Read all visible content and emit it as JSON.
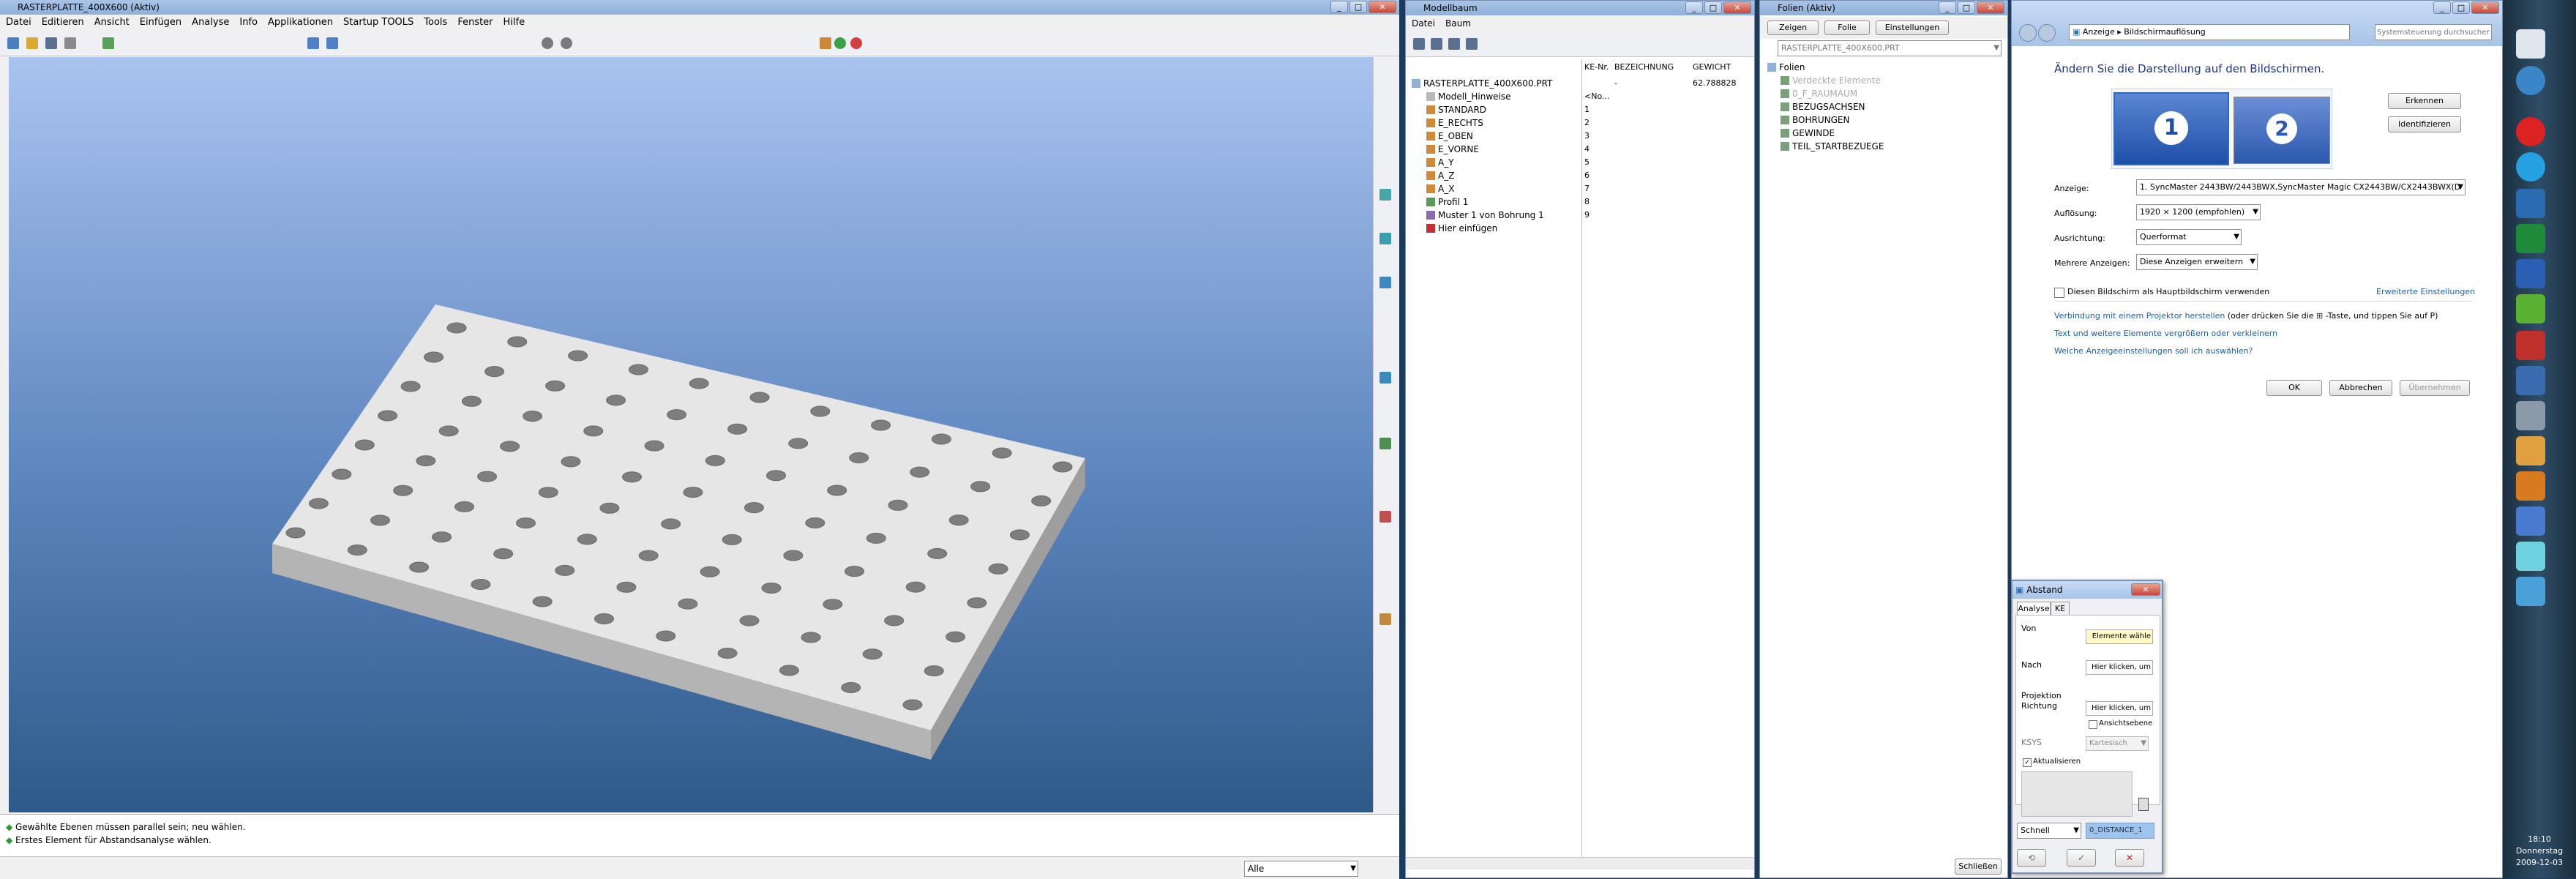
{
  "proe": {
    "title": "RASTERPLATTE_400X600 (Aktiv)",
    "menu": [
      "Datei",
      "Editieren",
      "Ansicht",
      "Einfügen",
      "Analyse",
      "Info",
      "Applikationen",
      "Startup TOOLS",
      "Tools",
      "Fenster",
      "Hilfe"
    ],
    "messages": [
      "Gewählte Ebenen müssen parallel sein; neu wählen.",
      "Erstes Element für Abstandsanalyse wählen."
    ],
    "filter_value": "Alle"
  },
  "modelltree": {
    "title": "Modellbaum",
    "menu": [
      "Datei",
      "Baum"
    ],
    "columns": [
      "KE-Nr.",
      "BEZEICHNUNG",
      "GEWICHT"
    ],
    "root": {
      "label": "RASTERPLATTE_400X600.PRT",
      "kenr": "",
      "bez": "-",
      "gew": "62.788828"
    },
    "items": [
      {
        "label": "Modell_Hinweise",
        "kenr": "<No..."
      },
      {
        "label": "STANDARD",
        "kenr": "1"
      },
      {
        "label": "E_RECHTS",
        "kenr": "2"
      },
      {
        "label": "E_OBEN",
        "kenr": "3"
      },
      {
        "label": "E_VORNE",
        "kenr": "4"
      },
      {
        "label": "A_Y",
        "kenr": "5"
      },
      {
        "label": "A_Z",
        "kenr": "6"
      },
      {
        "label": "A_X",
        "kenr": "7"
      },
      {
        "label": "Profil 1",
        "kenr": "8"
      },
      {
        "label": "Muster 1 von Bohrung 1",
        "kenr": "9"
      },
      {
        "label": "Hier einfügen",
        "kenr": ""
      }
    ]
  },
  "layers": {
    "title": "Folien (Aktiv)",
    "buttons": [
      "Zeigen",
      "Folie",
      "Einstellungen"
    ],
    "combo": "RASTERPLATTE_400X600.PRT",
    "items": [
      "Folien",
      "Verdeckte Elemente",
      "0_F_RAUMAUM",
      "BEZUGSACHSEN",
      "BOHRUNGEN",
      "GEWINDE",
      "TEIL_STARTBEZUEGE"
    ],
    "close": "Schließen"
  },
  "display": {
    "breadcrumb": [
      "Anzeige",
      "Bildschirmauflösung"
    ],
    "search_placeholder": "Systemsteuerung durchsuchen",
    "heading": "Ändern Sie die Darstellung auf den Bildschirmen.",
    "monitors": [
      "1",
      "2"
    ],
    "btn_detect": "Erkennen",
    "btn_identify": "Identifizieren",
    "labels": {
      "anzeige": "Anzeige:",
      "aufloesung": "Auflösung:",
      "ausrichtung": "Ausrichtung:",
      "mehrere": "Mehrere Anzeigen:"
    },
    "values": {
      "anzeige": "1. SyncMaster 2443BW/2443BWX,SyncMaster Magic CX2443BW/CX2443BWX(D",
      "aufloesung": "1920 × 1200 (empfohlen)",
      "ausrichtung": "Querformat",
      "mehrere": "Diese Anzeigen erweitern"
    },
    "checkbox_main": "Diesen Bildschirm als Hauptbildschirm verwenden",
    "advanced": "Erweiterte Einstellungen",
    "link1": "Verbindung mit einem Projektor herstellen",
    "link1_rest": "(oder drücken Sie die",
    "link1_rest2": "-Taste, und tippen Sie auf P)",
    "link2": "Text und weitere Elemente vergrößern oder verkleinern",
    "link3": "Welche Anzeigeeinstellungen soll ich auswählen?",
    "ok": "OK",
    "cancel": "Abbrechen",
    "apply": "Übernehmen"
  },
  "abstand": {
    "title": "Abstand",
    "tabs": [
      "Analyse",
      "KE"
    ],
    "von_label": "Von",
    "von_value": "Elemente wähle",
    "nach_label": "Nach",
    "nach_value": "Hier klicken, um",
    "projektion": "Projektion",
    "richtung_label": "Richtung",
    "richtung_value": "Hier klicken, um",
    "ansicht": "Ansichtsebene",
    "ksys_label": "KSYS",
    "ksys_value": "Kartesisch",
    "aktualisieren": "Aktualisieren",
    "schnell": "Schnell",
    "name": "0_DISTANCE_1"
  },
  "taskbar": {
    "time": "18:10",
    "day": "Donnerstag",
    "date": "2009-12-03"
  },
  "colors": {
    "viewport_top": "#a9c3f0",
    "viewport_bottom": "#2d5a8a",
    "plate_top": "#e4e4e4",
    "plate_side": "#b0b0b0"
  }
}
